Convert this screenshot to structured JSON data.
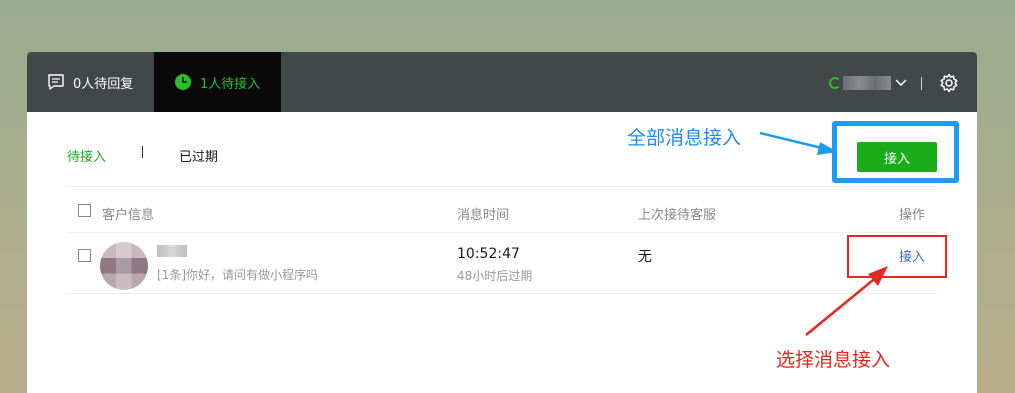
{
  "topbar": {
    "tab_reply": "0人待回复",
    "tab_pending": "1人待接入"
  },
  "subtabs": {
    "pending": "待接入",
    "expired": "已过期"
  },
  "accept_all_button": "接入",
  "table": {
    "headers": [
      "客户信息",
      "消息时间",
      "上次接待客服",
      "操作"
    ],
    "rows": [
      {
        "preview": "[1条]你好，请问有做小程序吗",
        "time": "10:52:47",
        "expires": "48小时后过期",
        "last_agent": "无",
        "action": "接入"
      }
    ]
  },
  "annotations": {
    "accept_all": "全部消息接入",
    "select_accept": "选择消息接入"
  },
  "colors": {
    "brand_green": "#1aad19",
    "annotation_blue": "#1c9bf0",
    "annotation_red": "#e8271d"
  }
}
